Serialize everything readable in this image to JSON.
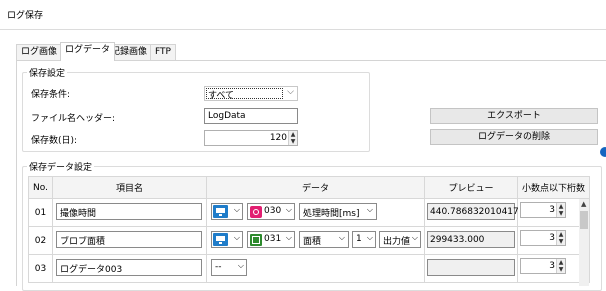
{
  "window": {
    "title": "ログ保存"
  },
  "tabs": [
    {
      "label": "ログ画像"
    },
    {
      "label": "ログデータ"
    },
    {
      "label": "記録画像"
    },
    {
      "label": "FTP"
    }
  ],
  "save_settings": {
    "legend": "保存設定",
    "condition_label": "保存条件:",
    "condition_value": "すべて",
    "header_label": "ファイル名ヘッダー:",
    "header_value": "LogData",
    "days_label": "保存数(日):",
    "days_value": "120"
  },
  "buttons": {
    "export": "エクスポート",
    "delete_log": "ログデータの削除"
  },
  "save_data": {
    "legend": "保存データ設定",
    "columns": [
      "No.",
      "項目名",
      "データ",
      "プレビュー",
      "小数点以下桁数"
    ],
    "rows": [
      {
        "no": "01",
        "name": "撮像時間",
        "tool_num": "030",
        "item": "処理時間[ms]",
        "preview": "440.786832010417",
        "decimals": "3"
      },
      {
        "no": "02",
        "name": "ブロブ面積",
        "tool_num": "031",
        "item": "面積",
        "index": "1",
        "output": "出力値",
        "preview": "299433.000",
        "decimals": "3"
      },
      {
        "no": "03",
        "name": "ログデータ003",
        "source": "--",
        "preview": "",
        "decimals": "3"
      }
    ]
  },
  "icons": {
    "monitor": "monitor-icon",
    "timer": "timer-icon",
    "area": "area-icon"
  },
  "colors": {
    "accent": "#1f7cc9",
    "timer": "#e21f71",
    "area": "#2d8a2d",
    "indicator": "#1565c0"
  }
}
